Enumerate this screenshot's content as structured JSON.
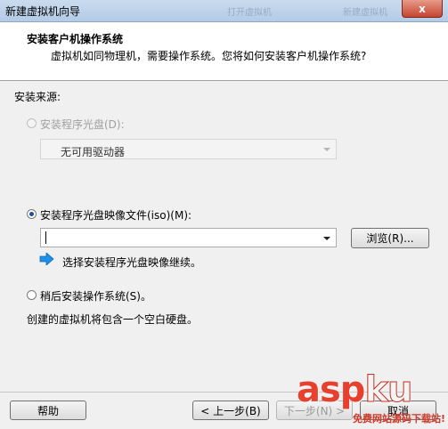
{
  "window": {
    "title": "新建虚拟机向导",
    "close_label": "x",
    "ghost_titles": [
      "打开虚拟机",
      "新建虚拟机"
    ]
  },
  "header": {
    "title": "安装客户机操作系统",
    "subtitle": "虚拟机如同物理机，需要操作系统。您将如何安装客户机操作系统?"
  },
  "source": {
    "label": "安装来源:",
    "disc": {
      "label": "安装程序光盘(D):",
      "selected": false,
      "enabled": false,
      "dropdown_value": "无可用驱动器"
    },
    "iso": {
      "label": "安装程序光盘映像文件(iso)(M):",
      "selected": true,
      "value": "",
      "browse_label": "浏览(R)...",
      "hint_icon": "blue-arrow-icon",
      "hint": "选择安装程序光盘映像继续。"
    },
    "later": {
      "label": "稍后安装操作系统(S)。",
      "selected": false,
      "description": "创建的虚拟机将包含一个空白硬盘。"
    }
  },
  "footer": {
    "help_label": "帮助",
    "back_label": "< 上一步(B)",
    "next_label": "下一步(N) >",
    "cancel_label": "取消"
  },
  "watermark": {
    "brand_left": "asp",
    "brand_right": "ku",
    "tagline": "免费网站源码下载站!"
  },
  "colors": {
    "radio_dot": "#1b4fa0",
    "hint_arrow": "#1e90e8",
    "watermark": "#e8402f"
  }
}
